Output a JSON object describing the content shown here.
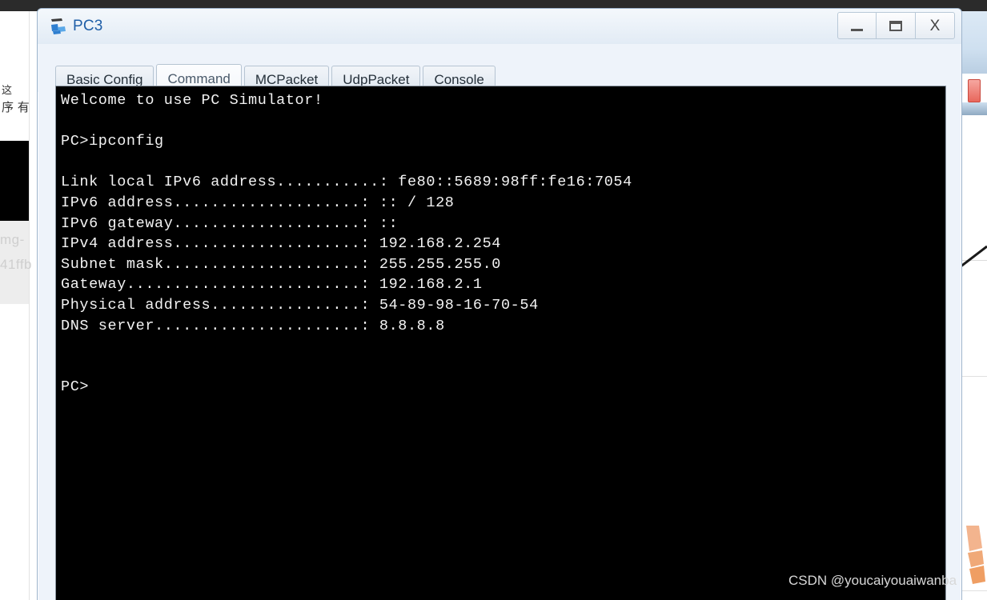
{
  "background": {
    "left_column_cjk_line1": "这",
    "left_column_cjk_line2": "序  有",
    "gray_text_line1": "mg-",
    "gray_text_line2": "41ffb"
  },
  "window": {
    "title": "PC3",
    "icon": "pc-device-icon",
    "controls": {
      "minimize_label": "_",
      "maximize_label": "☐",
      "close_label": "X"
    }
  },
  "tabs": [
    {
      "label": "Basic Config",
      "selected": false
    },
    {
      "label": "Command",
      "selected": true
    },
    {
      "label": "MCPacket",
      "selected": false
    },
    {
      "label": "UdpPacket",
      "selected": false
    },
    {
      "label": "Console",
      "selected": false
    }
  ],
  "terminal": {
    "lines": [
      "Welcome to use PC Simulator!",
      "",
      "PC>ipconfig",
      "",
      "Link local IPv6 address...........: fe80::5689:98ff:fe16:7054",
      "IPv6 address....................: :: / 128",
      "IPv6 gateway....................: ::",
      "IPv4 address....................: 192.168.2.254",
      "Subnet mask.....................: 255.255.255.0",
      "Gateway.........................: 192.168.2.1",
      "Physical address................: 54-89-98-16-70-54",
      "DNS server......................: 8.8.8.8",
      "",
      "",
      "PC>"
    ],
    "command_entered": "ipconfig",
    "prompt": "PC>",
    "values": {
      "link_local_ipv6_address": "fe80::5689:98ff:fe16:7054",
      "ipv6_address": ":: / 128",
      "ipv6_gateway": "::",
      "ipv4_address": "192.168.2.254",
      "subnet_mask": "255.255.255.0",
      "gateway": "192.168.2.1",
      "physical_address": "54-89-98-16-70-54",
      "dns_server": "8.8.8.8"
    }
  },
  "watermark": {
    "text": "CSDN @youcaiyouaiwanba"
  },
  "colors": {
    "terminal_bg": "#000000",
    "terminal_fg": "#f2f2f2",
    "title_text": "#1f5fa8",
    "window_bg": "#eef3fa",
    "topbar": "#2b2b2b"
  }
}
